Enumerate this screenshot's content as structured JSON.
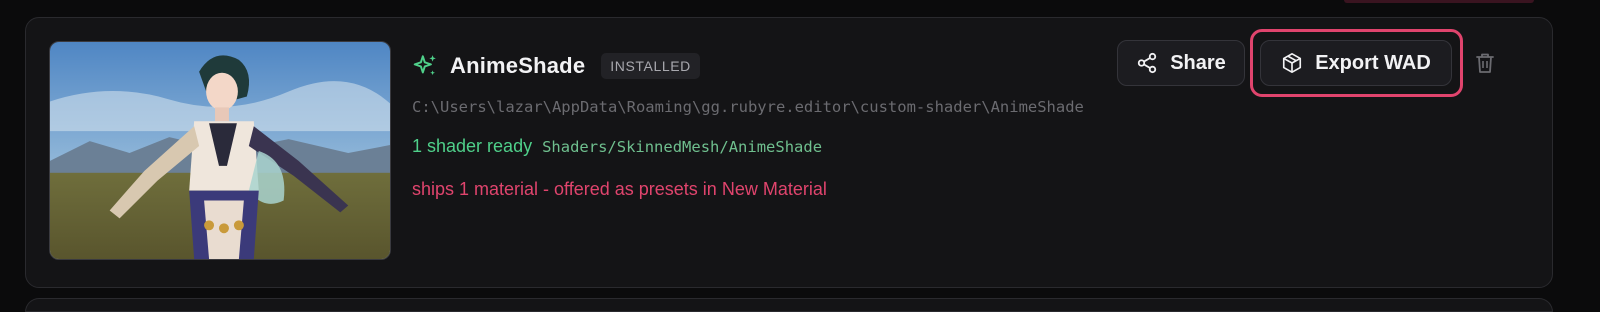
{
  "package": {
    "name": "AnimeShade",
    "status_badge": "INSTALLED",
    "path": "C:\\Users\\lazar\\AppData\\Roaming\\gg.rubyre.editor\\custom-shader\\AnimeShade",
    "ready_text": "1 shader ready",
    "shader_path": "Shaders/SkinnedMesh/AnimeShade",
    "materials_note": "ships 1 material - offered as presets in New Material"
  },
  "actions": {
    "share_label": "Share",
    "export_label": "Export WAD"
  },
  "icons": {
    "title": "sparkle-icon",
    "share": "share-icon",
    "export": "package-icon",
    "delete": "trash-icon"
  },
  "colors": {
    "accent_pink": "#e0446d",
    "ready_green": "#4fd08a",
    "card_bg": "#141416"
  }
}
